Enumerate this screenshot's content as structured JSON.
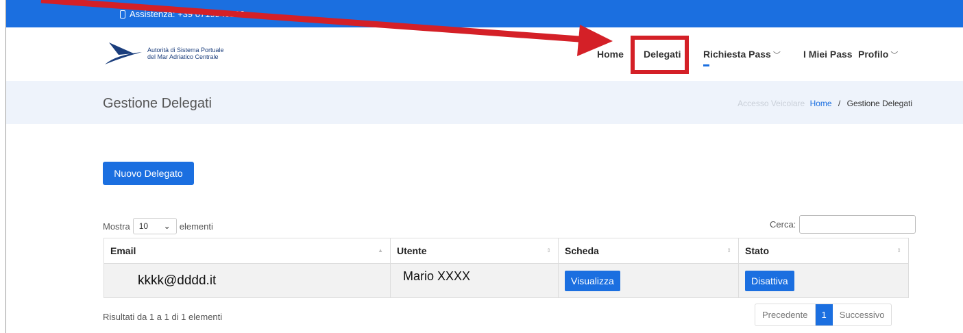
{
  "topbar": {
    "assistance": "Assistenza: +39 0719940192"
  },
  "logo": {
    "line1": "Autorità di Sistema Portuale",
    "line2": "del Mar Adriatico Centrale"
  },
  "nav": [
    {
      "label": "Home",
      "dropdown": false
    },
    {
      "label": "Delegati",
      "dropdown": false
    },
    {
      "label": "Richiesta Pass",
      "dropdown": true
    },
    {
      "label": "I Miei Pass",
      "dropdown": false
    },
    {
      "label": "Profilo",
      "dropdown": true
    }
  ],
  "page": {
    "title": "Gestione Delegati"
  },
  "breadcrumb": {
    "prefix": "Accesso Veicolare",
    "home": "Home",
    "separator": "/",
    "current": "Gestione Delegati"
  },
  "new_button": "Nuovo Delegato",
  "length": {
    "before": "Mostra",
    "value": "10",
    "after": "elementi"
  },
  "search": {
    "label": "Cerca:",
    "value": ""
  },
  "table": {
    "headers": [
      "Email",
      "Utente",
      "Scheda",
      "Stato"
    ],
    "rows": [
      {
        "email": "kkkk@dddd.it",
        "utente": "Mario XXXX",
        "scheda_button": "Visualizza",
        "stato_button": "Disattiva"
      }
    ]
  },
  "results": "Risultati da 1 a 1 di 1 elementi",
  "pagination": {
    "prev": "Precedente",
    "current": "1",
    "next": "Successivo"
  },
  "colors": {
    "primary": "#1b6fe0",
    "highlight": "#d42027",
    "pagehead_bg": "#eef3fb"
  }
}
